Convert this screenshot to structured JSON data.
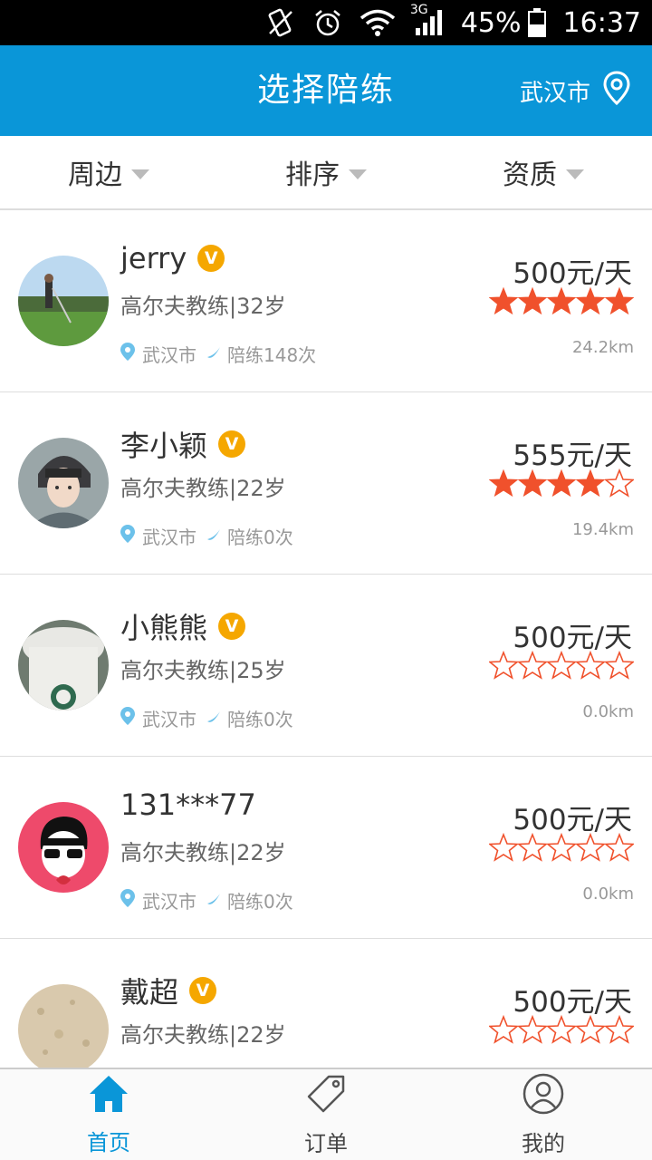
{
  "status_bar": {
    "battery": "45%",
    "time": "16:37",
    "network": "3G"
  },
  "header": {
    "title": "选择陪练",
    "city": "武汉市"
  },
  "filters": [
    {
      "label": "周边"
    },
    {
      "label": "排序"
    },
    {
      "label": "资质"
    }
  ],
  "coaches": [
    {
      "name": "jerry",
      "verified": true,
      "job": "高尔夫教练|32岁",
      "city": "武汉市",
      "sessions": "陪练148次",
      "price": "500元/天",
      "rating": 5,
      "distance": "24.2km"
    },
    {
      "name": "李小颖",
      "verified": true,
      "job": "高尔夫教练|22岁",
      "city": "武汉市",
      "sessions": "陪练0次",
      "price": "555元/天",
      "rating": 4,
      "distance": "19.4km"
    },
    {
      "name": "小熊熊",
      "verified": true,
      "job": "高尔夫教练|25岁",
      "city": "武汉市",
      "sessions": "陪练0次",
      "price": "500元/天",
      "rating": 0,
      "distance": "0.0km"
    },
    {
      "name": "131***77",
      "verified": false,
      "job": "高尔夫教练|22岁",
      "city": "武汉市",
      "sessions": "陪练0次",
      "price": "500元/天",
      "rating": 0,
      "distance": "0.0km"
    },
    {
      "name": "戴超",
      "verified": true,
      "job": "高尔夫教练|22岁",
      "city": "",
      "sessions": "",
      "price": "500元/天",
      "rating": 0,
      "distance": ""
    }
  ],
  "tabs": [
    {
      "label": "首页",
      "icon": "home-icon",
      "active": true
    },
    {
      "label": "订单",
      "icon": "tag-icon",
      "active": false
    },
    {
      "label": "我的",
      "icon": "user-icon",
      "active": false
    }
  ],
  "colors": {
    "primary": "#0a96d8",
    "star": "#f0512c",
    "badge": "#f5a700"
  }
}
